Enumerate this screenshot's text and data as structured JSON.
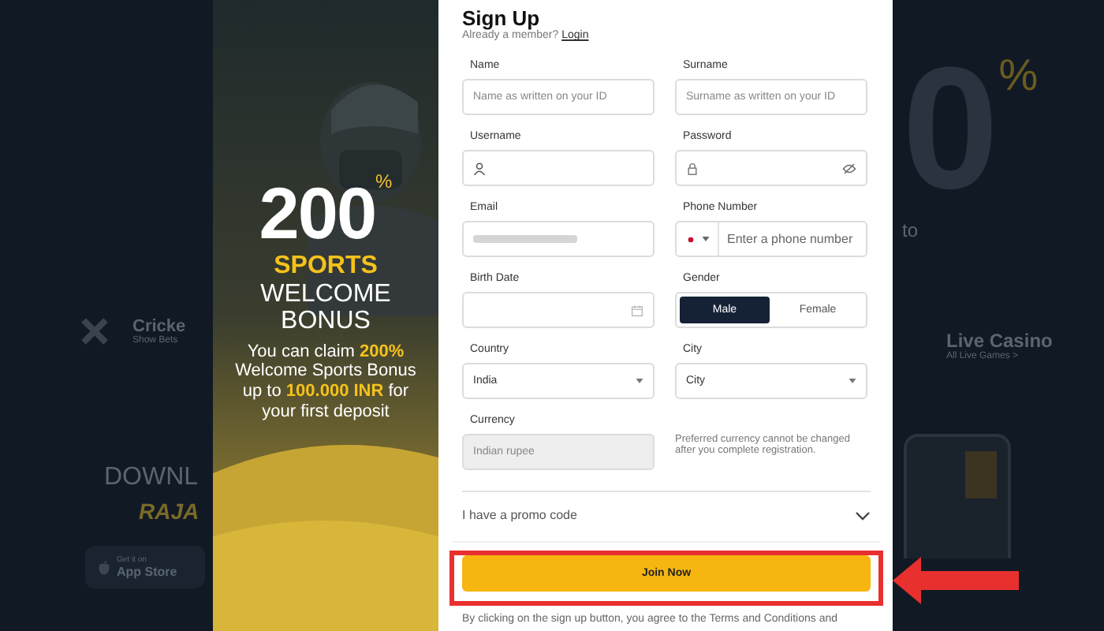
{
  "background_page": {
    "category_title": "Cricke",
    "category_link": "Show Bets",
    "download_title": "DOWNL",
    "download_brand": "RAJA",
    "store_caption": "Get it on",
    "store_name": "App Store",
    "hero_digit": "0",
    "hero_percent": "%",
    "hero_word": "to",
    "live_title": "Live Casino",
    "live_link": "All Live Games >"
  },
  "banner": {
    "number": "200",
    "percent": "%",
    "line1": "SPORTS",
    "line2": "WELCOME",
    "line3": "BONUS",
    "text": "You can claim **200%** Welcome Sports Bonus up to **100.000 INR** for your first deposit"
  },
  "signup": {
    "title": "Sign Up",
    "member_prompt": "Already a member?",
    "login_link": "Login",
    "fields": [
      {
        "kind": "text",
        "label": "Name",
        "placeholder": "Name as written on your ID"
      },
      {
        "kind": "text",
        "label": "Surname",
        "placeholder": "Surname as written on your ID"
      },
      {
        "kind": "username",
        "label": "Username"
      },
      {
        "kind": "password",
        "label": "Password"
      },
      {
        "kind": "masked",
        "label": "Email"
      },
      {
        "kind": "phone",
        "label": "Phone Number",
        "placeholder": "Enter a phone number"
      },
      {
        "kind": "date",
        "label": "Birth Date"
      },
      {
        "kind": "gender",
        "label": "Gender",
        "options": [
          {
            "label": "Male",
            "selected": true
          },
          {
            "label": "Female",
            "selected": false
          }
        ]
      },
      {
        "kind": "select",
        "label": "Country",
        "value": "India"
      },
      {
        "kind": "select",
        "label": "City",
        "value": "City"
      },
      {
        "kind": "readonly",
        "label": "Currency",
        "placeholder": "Indian rupee"
      },
      {
        "kind": "note",
        "text": "Preferred currency cannot be changed after you complete registration."
      }
    ],
    "promo": "I have a promo code",
    "join_button": "Join Now",
    "terms": "By clicking on the sign up button, you agree to the Terms and Conditions and"
  }
}
